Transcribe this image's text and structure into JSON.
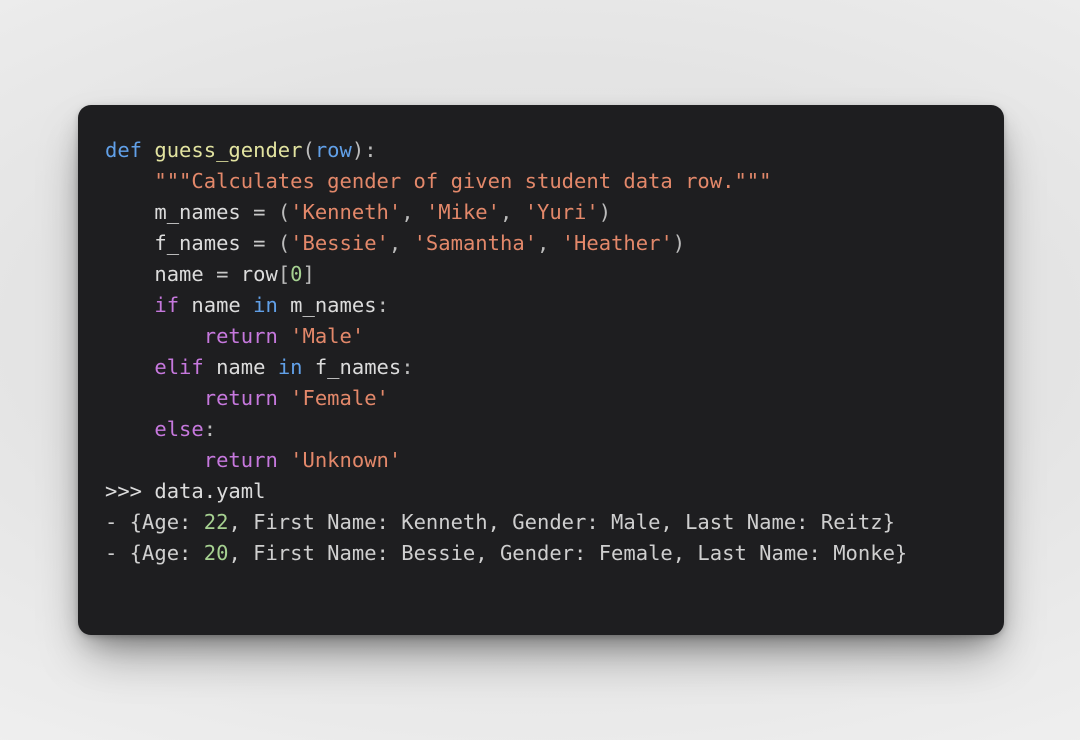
{
  "window": {
    "theme": "dark-code-card",
    "background_color": "#ececec",
    "card_color": "#1e1e20"
  },
  "colors": {
    "background": "#1e1e20",
    "keyword": "#c678dd",
    "def_keyword": "#61a0e8",
    "function_name": "#e2e3a0",
    "parameter": "#61a0e8",
    "string": "#e3886a",
    "docstring": "#e3886a",
    "number": "#a6d191",
    "plain_text": "#dcdcdc",
    "punctuation": "#bcbcbc"
  },
  "code": {
    "language": "python",
    "lines": [
      {
        "id": "line-1",
        "text": "def guess_gender(row):",
        "tokens": [
          {
            "t": "def",
            "c": "t-def"
          },
          {
            "t": " ",
            "c": "t-plain"
          },
          {
            "t": "guess_gender",
            "c": "t-fn"
          },
          {
            "t": "(",
            "c": "t-punc"
          },
          {
            "t": "row",
            "c": "t-param"
          },
          {
            "t": "):",
            "c": "t-punc"
          }
        ]
      },
      {
        "id": "line-2",
        "text": "    \"\"\"Calculates gender of given student data row.\"\"\"",
        "tokens": [
          {
            "t": "    ",
            "c": "t-plain"
          },
          {
            "t": "\"\"\"Calculates gender of given student data row.\"\"\"",
            "c": "t-doc"
          }
        ]
      },
      {
        "id": "line-3",
        "text": "    m_names = ('Kenneth', 'Mike', 'Yuri')",
        "tokens": [
          {
            "t": "    ",
            "c": "t-plain"
          },
          {
            "t": "m_names",
            "c": "t-name"
          },
          {
            "t": " ",
            "c": "t-plain"
          },
          {
            "t": "=",
            "c": "t-op"
          },
          {
            "t": " ",
            "c": "t-plain"
          },
          {
            "t": "(",
            "c": "t-punc"
          },
          {
            "t": "'Kenneth'",
            "c": "t-str"
          },
          {
            "t": ", ",
            "c": "t-punc"
          },
          {
            "t": "'Mike'",
            "c": "t-str"
          },
          {
            "t": ", ",
            "c": "t-punc"
          },
          {
            "t": "'Yuri'",
            "c": "t-str"
          },
          {
            "t": ")",
            "c": "t-punc"
          }
        ]
      },
      {
        "id": "line-4",
        "text": "    f_names = ('Bessie', 'Samantha', 'Heather')",
        "tokens": [
          {
            "t": "    ",
            "c": "t-plain"
          },
          {
            "t": "f_names",
            "c": "t-name"
          },
          {
            "t": " ",
            "c": "t-plain"
          },
          {
            "t": "=",
            "c": "t-op"
          },
          {
            "t": " ",
            "c": "t-plain"
          },
          {
            "t": "(",
            "c": "t-punc"
          },
          {
            "t": "'Bessie'",
            "c": "t-str"
          },
          {
            "t": ", ",
            "c": "t-punc"
          },
          {
            "t": "'Samantha'",
            "c": "t-str"
          },
          {
            "t": ", ",
            "c": "t-punc"
          },
          {
            "t": "'Heather'",
            "c": "t-str"
          },
          {
            "t": ")",
            "c": "t-punc"
          }
        ]
      },
      {
        "id": "line-5",
        "text": "    name = row[0]",
        "tokens": [
          {
            "t": "    ",
            "c": "t-plain"
          },
          {
            "t": "name",
            "c": "t-name"
          },
          {
            "t": " ",
            "c": "t-plain"
          },
          {
            "t": "=",
            "c": "t-op"
          },
          {
            "t": " ",
            "c": "t-plain"
          },
          {
            "t": "row",
            "c": "t-name"
          },
          {
            "t": "[",
            "c": "t-punc"
          },
          {
            "t": "0",
            "c": "t-num"
          },
          {
            "t": "]",
            "c": "t-punc"
          }
        ]
      },
      {
        "id": "line-6",
        "text": "    if name in m_names:",
        "tokens": [
          {
            "t": "    ",
            "c": "t-plain"
          },
          {
            "t": "if",
            "c": "t-kw"
          },
          {
            "t": " ",
            "c": "t-plain"
          },
          {
            "t": "name",
            "c": "t-name"
          },
          {
            "t": " ",
            "c": "t-plain"
          },
          {
            "t": "in",
            "c": "t-param"
          },
          {
            "t": " ",
            "c": "t-plain"
          },
          {
            "t": "m_names",
            "c": "t-name"
          },
          {
            "t": ":",
            "c": "t-punc"
          }
        ]
      },
      {
        "id": "line-7",
        "text": "        return 'Male'",
        "tokens": [
          {
            "t": "        ",
            "c": "t-plain"
          },
          {
            "t": "return",
            "c": "t-kw"
          },
          {
            "t": " ",
            "c": "t-plain"
          },
          {
            "t": "'Male'",
            "c": "t-str"
          }
        ]
      },
      {
        "id": "line-8",
        "text": "    elif name in f_names:",
        "tokens": [
          {
            "t": "    ",
            "c": "t-plain"
          },
          {
            "t": "elif",
            "c": "t-kw"
          },
          {
            "t": " ",
            "c": "t-plain"
          },
          {
            "t": "name",
            "c": "t-name"
          },
          {
            "t": " ",
            "c": "t-plain"
          },
          {
            "t": "in",
            "c": "t-param"
          },
          {
            "t": " ",
            "c": "t-plain"
          },
          {
            "t": "f_names",
            "c": "t-name"
          },
          {
            "t": ":",
            "c": "t-punc"
          }
        ]
      },
      {
        "id": "line-9",
        "text": "        return 'Female'",
        "tokens": [
          {
            "t": "        ",
            "c": "t-plain"
          },
          {
            "t": "return",
            "c": "t-kw"
          },
          {
            "t": " ",
            "c": "t-plain"
          },
          {
            "t": "'Female'",
            "c": "t-str"
          }
        ]
      },
      {
        "id": "line-10",
        "text": "    else:",
        "tokens": [
          {
            "t": "    ",
            "c": "t-plain"
          },
          {
            "t": "else",
            "c": "t-kw"
          },
          {
            "t": ":",
            "c": "t-punc"
          }
        ]
      },
      {
        "id": "line-11",
        "text": "        return 'Unknown'",
        "tokens": [
          {
            "t": "        ",
            "c": "t-plain"
          },
          {
            "t": "return",
            "c": "t-kw"
          },
          {
            "t": " ",
            "c": "t-plain"
          },
          {
            "t": "'Unknown'",
            "c": "t-str"
          }
        ]
      },
      {
        "id": "line-12",
        "text": ">>> data.yaml",
        "tokens": [
          {
            "t": ">>> ",
            "c": "t-prompt"
          },
          {
            "t": "data.yaml",
            "c": "t-plain"
          }
        ]
      },
      {
        "id": "line-13",
        "text": "- {Age: 22, First Name: Kenneth, Gender: Male, Last Name: Reitz}",
        "tokens": [
          {
            "t": "- {Age: ",
            "c": "t-yaml"
          },
          {
            "t": "22",
            "c": "t-num"
          },
          {
            "t": ", First Name: Kenneth, Gender: Male, Last Name: Reitz}",
            "c": "t-yaml"
          }
        ]
      },
      {
        "id": "line-14",
        "text": "- {Age: 20, First Name: Bessie, Gender: Female, Last Name: Monke}",
        "tokens": [
          {
            "t": "- {Age: ",
            "c": "t-yaml"
          },
          {
            "t": "20",
            "c": "t-num"
          },
          {
            "t": ", First Name: Bessie, Gender: Female, Last Name: Monke}",
            "c": "t-yaml"
          }
        ]
      }
    ]
  },
  "repl": {
    "prompt": ">>>",
    "command": "data.yaml"
  },
  "yaml_records": [
    {
      "Age": "22",
      "First Name": "Kenneth",
      "Gender": "Male",
      "Last Name": "Reitz"
    },
    {
      "Age": "20",
      "First Name": "Bessie",
      "Gender": "Female",
      "Last Name": "Monke"
    }
  ]
}
